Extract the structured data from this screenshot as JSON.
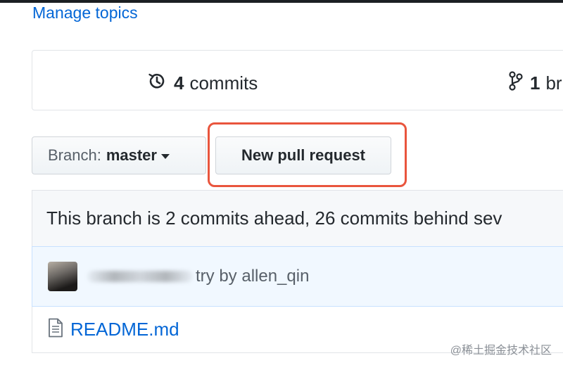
{
  "repo": {
    "manage_topics": "Manage topics",
    "summary": {
      "commits_count": "4",
      "commits_label": "commits",
      "branches_count": "1",
      "branches_label": "br"
    },
    "branch_select": {
      "prefix": "Branch:",
      "name": "master"
    },
    "new_pr_label": "New pull request",
    "ahead_behind": "This branch is 2 commits ahead, 26 commits behind sev",
    "latest_commit": {
      "message": "try by allen_qin"
    },
    "files": [
      {
        "name": "README.md"
      }
    ]
  },
  "annotation": {
    "highlight_color": "#e9553d"
  },
  "icons": {
    "commits": "history-icon",
    "branches": "git-branch-icon",
    "file": "file-icon",
    "dropdown": "caret-down-icon"
  },
  "watermark": "@稀土掘金技术社区"
}
